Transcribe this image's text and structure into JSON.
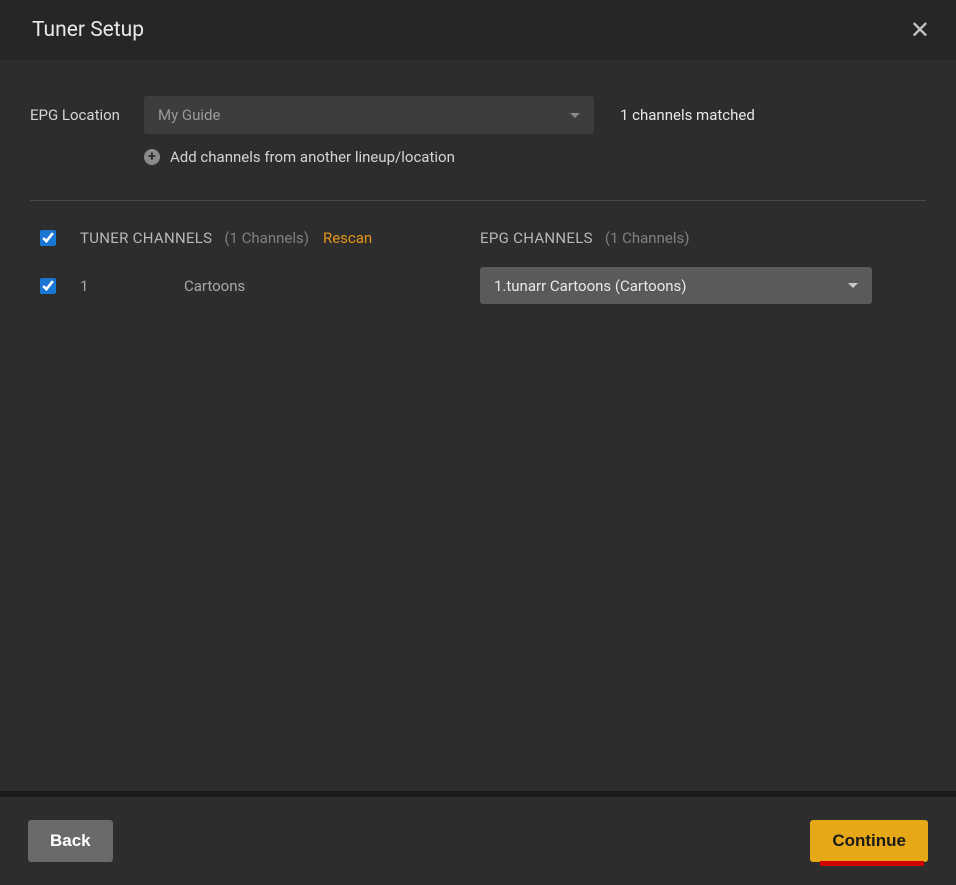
{
  "header": {
    "title": "Tuner Setup"
  },
  "epg": {
    "label": "EPG Location",
    "selected": "My Guide",
    "matched": "1 channels matched",
    "add_link": "Add channels from another lineup/location"
  },
  "tuner": {
    "heading": "TUNER CHANNELS",
    "count": "(1 Channels)",
    "rescan": "Rescan"
  },
  "epg_col": {
    "heading": "EPG CHANNELS",
    "count": "(1 Channels)"
  },
  "channels": [
    {
      "number": "1",
      "name": "Cartoons",
      "epg_match": "1.tunarr Cartoons (Cartoons)"
    }
  ],
  "footer": {
    "back": "Back",
    "continue": "Continue"
  }
}
